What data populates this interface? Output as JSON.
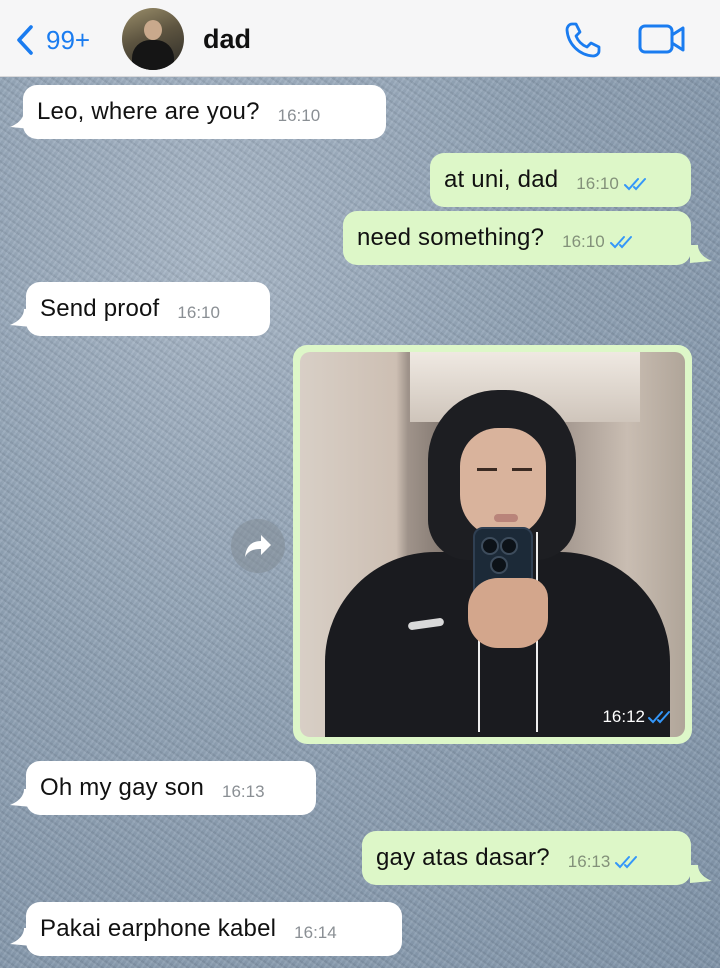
{
  "header": {
    "back_count": "99+",
    "contact_name": "dad",
    "accent_color": "#1a7cf0",
    "icons": [
      "chevron-left-icon",
      "phone-icon",
      "video-call-icon"
    ]
  },
  "messages": [
    {
      "direction": "incoming",
      "text": "Leo, where are you?",
      "time": "16:10"
    },
    {
      "direction": "outgoing",
      "text": "at uni, dad",
      "time": "16:10",
      "status": "read"
    },
    {
      "direction": "outgoing",
      "text": "need something?",
      "time": "16:10",
      "status": "read"
    },
    {
      "direction": "incoming",
      "text": "Send proof",
      "time": "16:10"
    },
    {
      "direction": "outgoing",
      "type": "photo",
      "time": "16:12",
      "status": "read"
    },
    {
      "direction": "incoming",
      "text": "Oh my gay son",
      "time": "16:13"
    },
    {
      "direction": "outgoing",
      "text": "gay atas dasar?",
      "time": "16:13",
      "status": "read"
    },
    {
      "direction": "incoming",
      "text": "Pakai earphone kabel",
      "time": "16:14"
    }
  ],
  "colors": {
    "incoming_bubble": "#ffffff",
    "outgoing_bubble": "#ddf7c8",
    "read_ticks": "#3497f9"
  }
}
